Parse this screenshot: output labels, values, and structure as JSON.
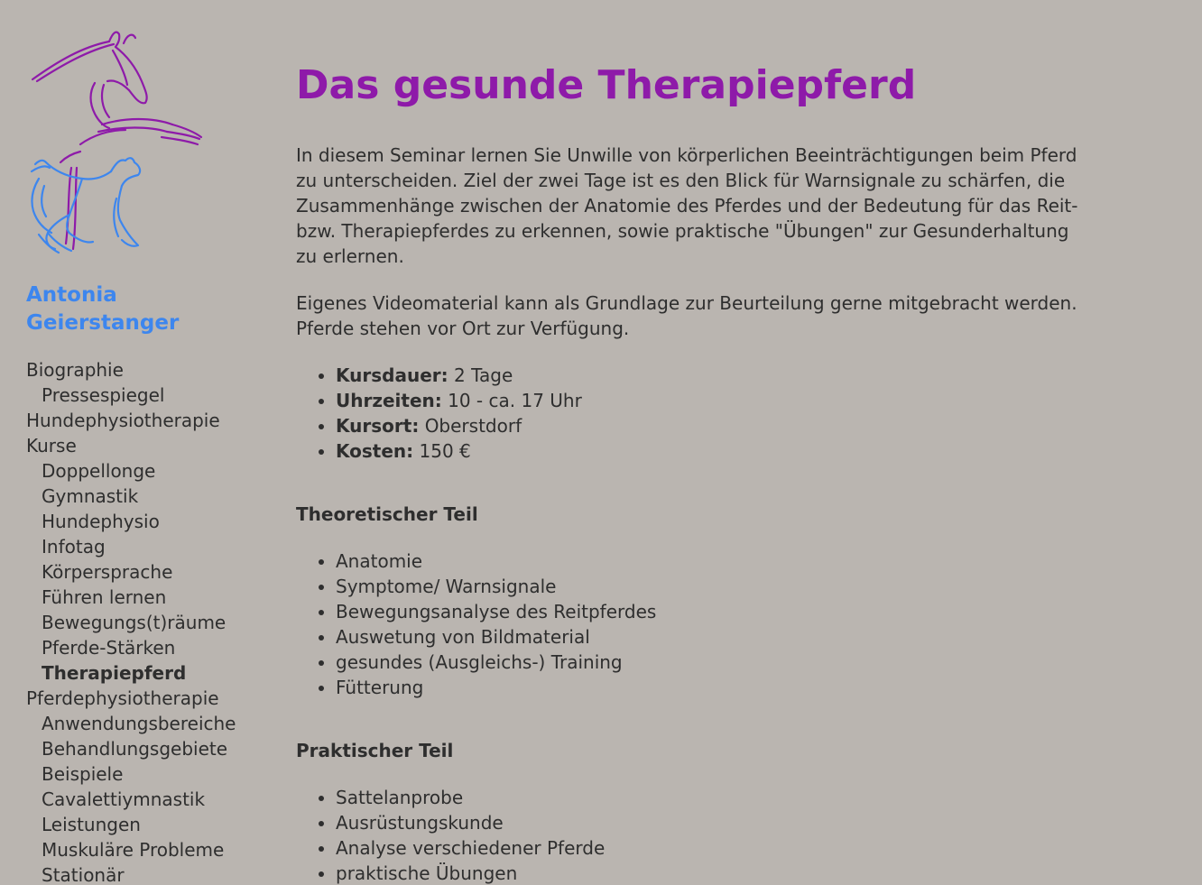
{
  "brand": {
    "logo_icon": "horse-dog-line-art-logo",
    "colors": {
      "horse": "#8e1aa9",
      "dog": "#3d86ee"
    },
    "name_line1": "Antonia",
    "name_line2": "Geierstanger"
  },
  "nav": {
    "items": [
      {
        "label": "Biographie",
        "level": 0
      },
      {
        "label": "Pressespiegel",
        "level": 1
      },
      {
        "label": "Hundephysiotherapie",
        "level": 0
      },
      {
        "label": "Kurse",
        "level": 0
      },
      {
        "label": "Doppellonge",
        "level": 1
      },
      {
        "label": "Gymnastik",
        "level": 1
      },
      {
        "label": "Hundephysio",
        "level": 1
      },
      {
        "label": "Infotag",
        "level": 1
      },
      {
        "label": "Körpersprache",
        "level": 1
      },
      {
        "label": "Führen lernen",
        "level": 1
      },
      {
        "label": "Bewegungs(t)räume",
        "level": 1
      },
      {
        "label": "Pferde-Stärken",
        "level": 1
      },
      {
        "label": "Therapiepferd",
        "level": 1,
        "active": true
      },
      {
        "label": "Pferdephysiotherapie",
        "level": 0
      },
      {
        "label": "Anwendungsbereiche",
        "level": 1
      },
      {
        "label": "Behandlungsgebiete",
        "level": 1
      },
      {
        "label": "Beispiele",
        "level": 1
      },
      {
        "label": "Cavalettiymnastik",
        "level": 1
      },
      {
        "label": "Leistungen",
        "level": 1
      },
      {
        "label": "Muskuläre Probleme",
        "level": 1
      },
      {
        "label": "Stationär",
        "level": 1
      }
    ]
  },
  "main": {
    "title": "Das gesunde Therapiepferd",
    "intro": "In diesem Seminar lernen Sie Unwille von körperlichen Beeinträchtigungen beim Pferd zu unterscheiden. Ziel der zwei Tage ist es den Blick für Warnsignale zu schärfen, die Zusammenhänge zwischen der Anatomie des Pferdes und der Bedeutung für das Reit- bzw. Therapiepferdes zu erkennen, sowie praktische \"Übungen\" zur Gesunderhaltung zu erlernen.",
    "video_note": "Eigenes Videomaterial kann als Grundlage zur Beurteilung gerne mitgebracht werden. Pferde stehen vor Ort zur Verfügung.",
    "facts": [
      {
        "label": "Kursdauer",
        "sep": ":",
        "value": "2 Tage"
      },
      {
        "label": "Uhrzeiten",
        "sep": ":",
        "value": "10 - ca. 17 Uhr"
      },
      {
        "label": "Kursort",
        "sep": ":",
        "value": "Oberstdorf"
      },
      {
        "label": "Kosten",
        "sep": ":",
        "value": "150 €"
      }
    ],
    "theory": {
      "heading": "Theoretischer Teil",
      "items": [
        "Anatomie",
        "Symptome/ Warnsignale",
        "Bewegungsanalyse des Reitpferdes",
        "Auswetung von Bildmaterial",
        "gesundes (Ausgleichs-) Training",
        "Fütterung"
      ]
    },
    "practice": {
      "heading": "Praktischer Teil",
      "items": [
        "Sattelanprobe",
        "Ausrüstungskunde",
        "Analyse verschiedener Pferde",
        "praktische Übungen"
      ]
    }
  }
}
